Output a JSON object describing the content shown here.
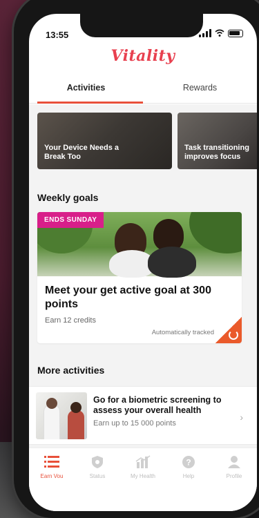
{
  "status": {
    "time": "13:55"
  },
  "app": {
    "logo_text": "Vitality",
    "accent": "#e8503a",
    "badge_color": "#d81f8a"
  },
  "tabs": [
    {
      "label": "Activities",
      "active": true
    },
    {
      "label": "Rewards",
      "active": false
    }
  ],
  "promos": [
    {
      "label": "Your Device Needs a\nBreak Too"
    },
    {
      "label": "Task transitioning\nimproves focus"
    }
  ],
  "weekly_goals": {
    "title": "Weekly goals",
    "badge": "ENDS SUNDAY",
    "goal_title": "Meet your get active goal at 300 points",
    "credits": "Earn 12 credits",
    "tracking": "Automatically tracked"
  },
  "more_activities": {
    "title": "More activities",
    "items": [
      {
        "title": "Go for a biometric screening to assess your overall health",
        "subtitle": "Earn up to 15 000 points"
      }
    ]
  },
  "bottom_nav": [
    {
      "label": "Earn Vou",
      "icon": "list-icon",
      "active": true
    },
    {
      "label": "Status",
      "icon": "shield-icon",
      "active": false
    },
    {
      "label": "My Health",
      "icon": "bar-chart-icon",
      "active": false
    },
    {
      "label": "Help",
      "icon": "help-icon",
      "active": false
    },
    {
      "label": "Profile",
      "icon": "profile-icon",
      "active": false
    }
  ]
}
